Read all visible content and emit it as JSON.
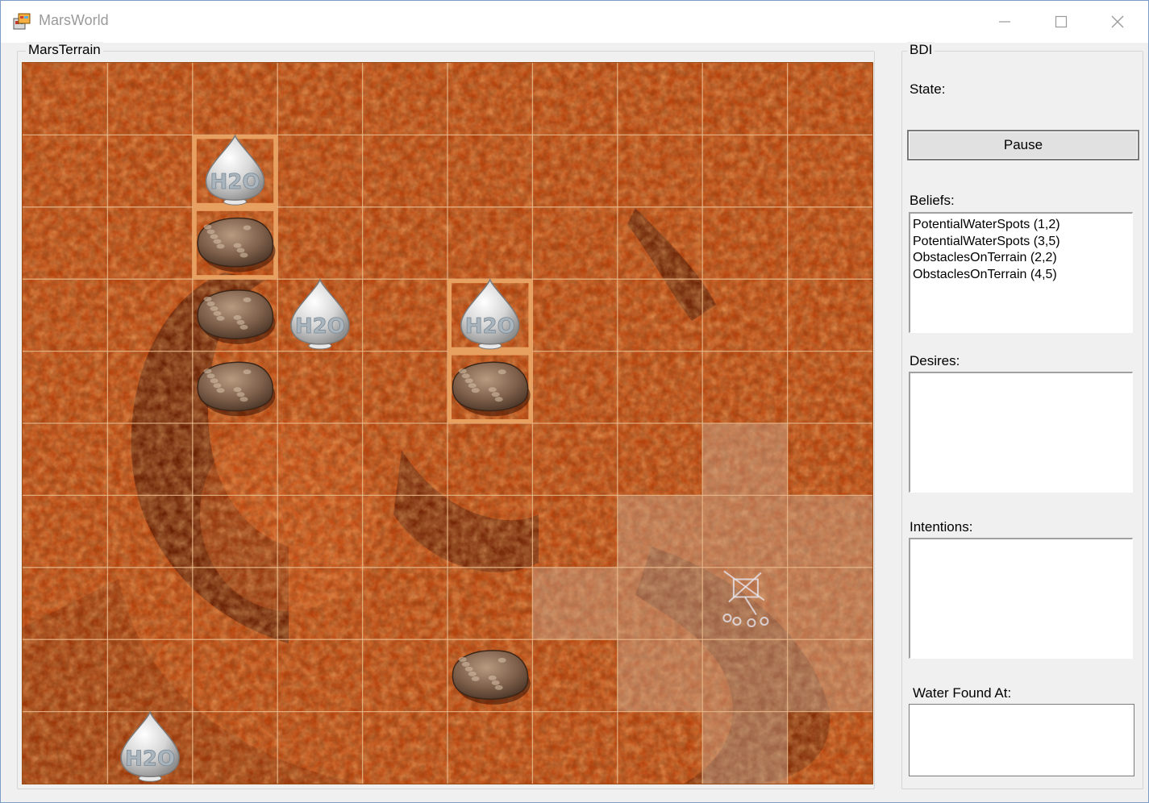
{
  "window": {
    "title": "MarsWorld"
  },
  "terrain": {
    "group_label": "MarsTerrain",
    "grid": {
      "cols": 10,
      "rows": 10
    },
    "water_spots": [
      [
        2,
        1
      ],
      [
        3,
        3
      ],
      [
        5,
        3
      ],
      [
        1,
        9
      ]
    ],
    "rocks": [
      [
        2,
        2
      ],
      [
        2,
        3
      ],
      [
        2,
        4
      ],
      [
        5,
        4
      ],
      [
        5,
        8
      ]
    ],
    "highlighted_cells": [
      [
        2,
        1
      ],
      [
        2,
        2
      ],
      [
        5,
        3
      ],
      [
        5,
        4
      ]
    ],
    "explored_cells": [
      [
        8,
        5
      ],
      [
        7,
        6
      ],
      [
        8,
        6
      ],
      [
        9,
        6
      ],
      [
        6,
        7
      ],
      [
        7,
        7
      ],
      [
        8,
        7
      ],
      [
        9,
        7
      ],
      [
        7,
        8
      ],
      [
        8,
        8
      ],
      [
        9,
        8
      ],
      [
        8,
        9
      ]
    ],
    "rover_cell": [
      8,
      7
    ],
    "icon_label": "H2O"
  },
  "bdi": {
    "group_label": "BDI",
    "state_label": "State:",
    "state_value": "",
    "pause_label": "Pause",
    "beliefs_label": "Beliefs:",
    "beliefs": [
      "PotentialWaterSpots (1,2)",
      "PotentialWaterSpots (3,5)",
      "ObstaclesOnTerrain (2,2)",
      "ObstaclesOnTerrain (4,5)"
    ],
    "desires_label": "Desires:",
    "desires": [],
    "intentions_label": "Intentions:",
    "intentions": [],
    "water_found_label": "Water Found At:",
    "water_found": []
  },
  "colors": {
    "terrain_base": "#b8450f",
    "terrain_dark": "#5a1a04",
    "grid_line": "#e8b98c",
    "highlight": "#e8a060",
    "explored_overlay": "#c8b8a8"
  }
}
